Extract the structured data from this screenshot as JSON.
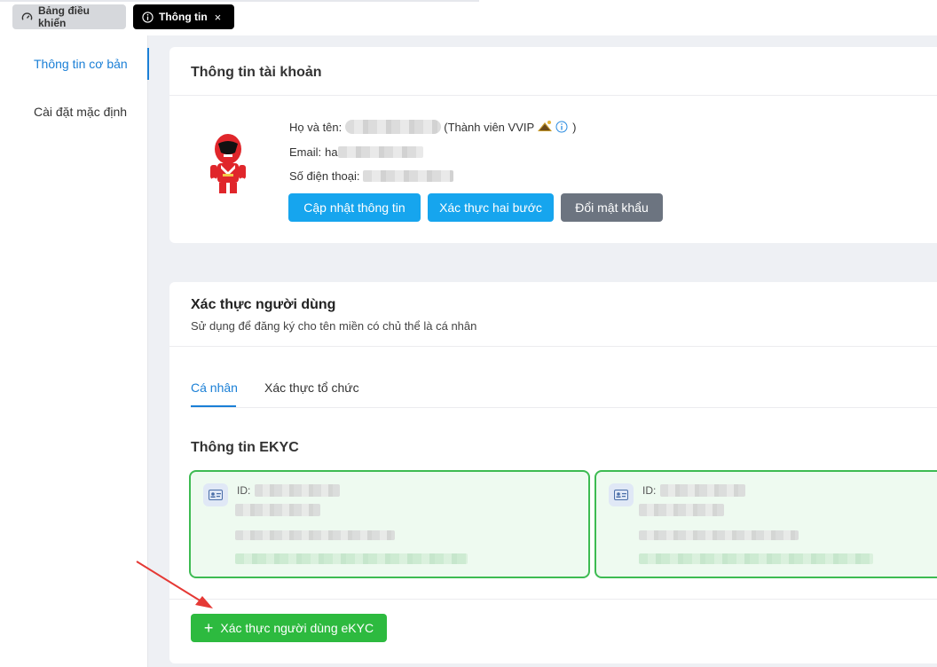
{
  "tabs": {
    "dashboard_label": "Bảng điều khiển",
    "info_label": "Thông tin",
    "close_glyph": "×"
  },
  "sidebar": {
    "items": [
      {
        "label": "Thông tin cơ bản",
        "active": true
      },
      {
        "label": "Cài đặt mặc định",
        "active": false
      }
    ]
  },
  "account": {
    "title": "Thông tin tài khoản",
    "name_label": "Họ và tên:",
    "member_prefix": "(Thành viên VVIP",
    "member_suffix": ")",
    "email_label": "Email:",
    "email_visible": "ha",
    "phone_label": "Số điện thoại:",
    "buttons": {
      "update": "Cập nhật thông tin",
      "two_factor": "Xác thực hai bước",
      "password": "Đổi mật khẩu"
    }
  },
  "verify": {
    "title": "Xác thực người dùng",
    "subtitle": "Sử dụng để đăng ký cho tên miền có chủ thể là cá nhân",
    "tabs": [
      "Cá nhân",
      "Xác thực tổ chức"
    ],
    "ekyc_title": "Thông tin EKYC",
    "cards": [
      {
        "id_label": "ID:"
      },
      {
        "id_label": "ID:"
      }
    ],
    "add_button": "Xác thực người dùng eKYC",
    "add_glyph": "+"
  },
  "colors": {
    "primary": "#16a5ee",
    "secondary": "#6c7480",
    "success": "#2dba3f",
    "active": "#1a7fd6",
    "annotation_arrow": "#e53935"
  }
}
